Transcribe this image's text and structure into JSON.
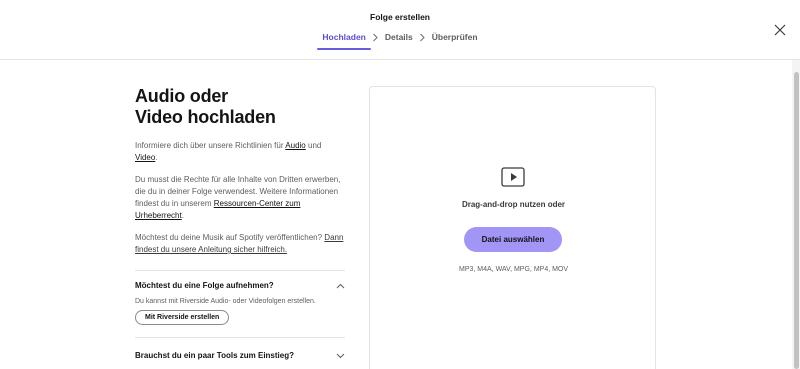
{
  "header": {
    "title": "Folge erstellen",
    "steps": [
      "Hochladen",
      "Details",
      "Überprüfen"
    ]
  },
  "left": {
    "heading_line1": "Audio oder",
    "heading_line2": "Video hochladen",
    "guidelines_prefix": "Informiere dich über unsere Richtlinien für ",
    "guidelines_audio": "Audio",
    "guidelines_and": " und",
    "guidelines_video": "Video",
    "guidelines_end": ".",
    "rights_text": "Du musst die Rechte für alle Inhalte von Dritten erwerben, die du in deiner Folge verwendest. Weitere Informationen findest du in unserem ",
    "rights_link": "Ressourcen-Center zum Urheberrecht",
    "rights_end": ".",
    "music_text": "Möchtest du deine Musik auf Spotify veröffentlichen? ",
    "music_link": "Dann findest du unsere Anleitung sicher hilfreich.",
    "accordion1": {
      "title": "Möchtest du eine Folge aufnehmen?",
      "body": "Du kannst mit Riverside Audio- oder Videofolgen erstellen.",
      "button": "Mit Riverside erstellen"
    },
    "accordion2": {
      "title": "Brauchst du ein paar Tools zum Einstieg?"
    }
  },
  "dropzone": {
    "icon": "video-play-icon",
    "text": "Drag-and-drop nutzen oder",
    "button": "Datei auswählen",
    "formats": "MP3, M4A, WAV, MPG, MP4, MOV"
  },
  "colors": {
    "accent": "#5b4ddb",
    "button_bg": "#a195f6"
  }
}
